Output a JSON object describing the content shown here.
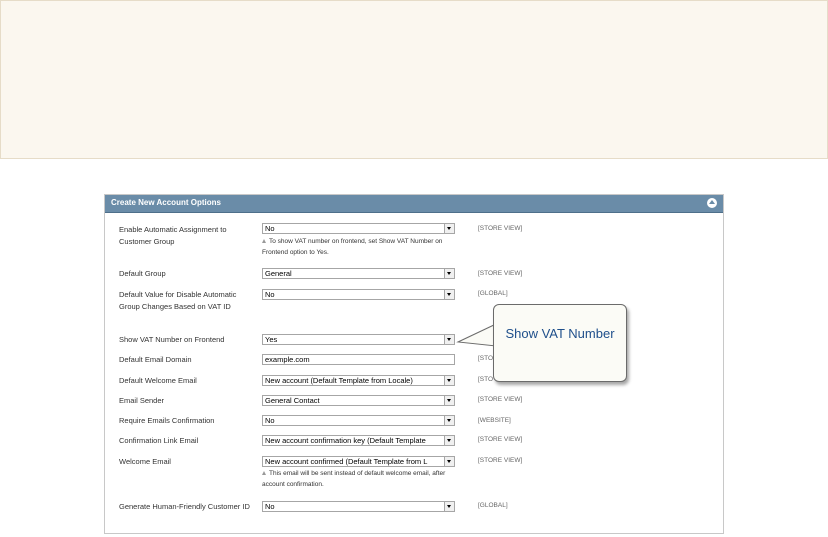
{
  "panel": {
    "title": "Create New Account Options"
  },
  "rows": [
    {
      "label": "Enable Automatic Assignment to Customer Group",
      "value": "No",
      "scope": "[STORE VIEW]",
      "note": "To show VAT number on frontend, set Show VAT Number on Frontend option to Yes."
    },
    {
      "label": "Default Group",
      "value": "General",
      "scope": "[STORE VIEW]"
    },
    {
      "label": "Default Value for Disable Automatic Group Changes Based on VAT ID",
      "value": "No",
      "scope": "[GLOBAL]"
    },
    {
      "label": "Show VAT Number on Frontend",
      "value": "Yes",
      "scope": ""
    },
    {
      "label": "Default Email Domain",
      "value": "example.com",
      "scope": "[STO"
    },
    {
      "label": "Default Welcome Email",
      "value": "New account (Default Template from Locale)",
      "scope": "[STO"
    },
    {
      "label": "Email Sender",
      "value": "General Contact",
      "scope": "[STORE VIEW]"
    },
    {
      "label": "Require Emails Confirmation",
      "value": "No",
      "scope": "[WEBSITE]"
    },
    {
      "label": "Confirmation Link Email",
      "value": "New account confirmation key (Default Template",
      "scope": "[STORE VIEW]"
    },
    {
      "label": "Welcome Email",
      "value": "New account confirmed (Default Template from L",
      "scope": "[STORE VIEW]",
      "note": "This email will be sent instead of default welcome email, after account confirmation."
    },
    {
      "label": "Generate Human-Friendly Customer ID",
      "value": "No",
      "scope": "[GLOBAL]"
    }
  ],
  "callout": {
    "text": "Show VAT Number"
  },
  "colors": {
    "header": "#6a8ca8",
    "callout_text": "#1f4f8b",
    "banner": "#fbf7ef"
  }
}
